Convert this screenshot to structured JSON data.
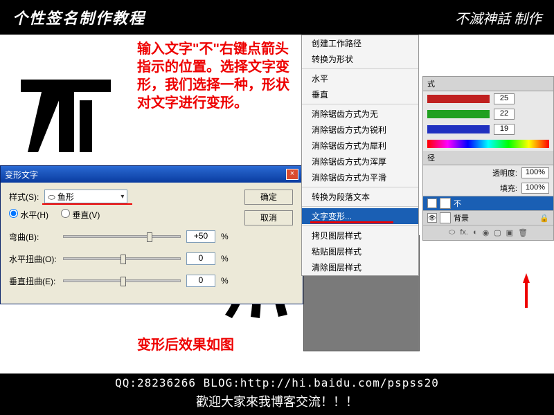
{
  "header": {
    "title": "个性签名制作教程",
    "logo": "不滅神話 制作"
  },
  "instruction": "输入文字\"不\"右键点箭头指示的位置。选择文字变形，我们选择一种，形状对文字进行变形。",
  "context_menu": {
    "items": [
      "创建工作路径",
      "转换为形状",
      "水平",
      "垂直",
      "消除锯齿方式为无",
      "消除锯齿方式为锐利",
      "消除锯齿方式为犀利",
      "消除锯齿方式为浑厚",
      "消除锯齿方式为平滑",
      "转换为段落文本",
      "文字变形...",
      "拷贝图层样式",
      "粘贴图层样式",
      "清除图层样式"
    ],
    "selected_index": 10
  },
  "panel": {
    "tab": "式",
    "r": "25",
    "g": "22",
    "b": "19",
    "opacity_label": "透明度:",
    "opacity": "100%",
    "fill_label": "填充:",
    "fill": "100%",
    "layer_text": "不",
    "layer_bg": "背景",
    "path_label": "径"
  },
  "dialog": {
    "title": "变形文字",
    "style_label": "样式(S):",
    "style_value": "⬭ 鱼形",
    "ok": "确定",
    "cancel": "取消",
    "horiz": "水平(H)",
    "vert": "垂直(V)",
    "bend_label": "弯曲(B):",
    "bend": "+50",
    "hdist_label": "水平扭曲(O):",
    "hdist": "0",
    "vdist_label": "垂直扭曲(E):",
    "vdist": "0",
    "pct": "%"
  },
  "result_label": "变形后效果如图",
  "footer": {
    "line1": "QQ:28236266  BLOG:http://hi.baidu.com/pspss20",
    "line2": "歡迎大家來我博客交流！！！"
  }
}
